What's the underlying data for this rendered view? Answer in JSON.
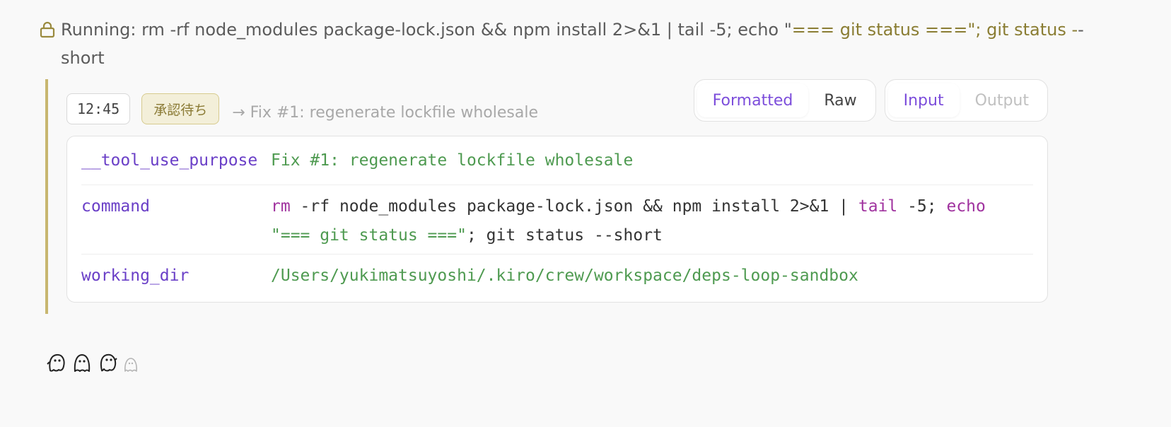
{
  "header": {
    "status_prefix": "Running: ",
    "command_plain": "rm -rf node_modules package-lock.json && npm install 2>&1 | tail -5; echo \"",
    "command_highlight": "=== git status ===\"; git status -",
    "command_tail": "-short"
  },
  "entry": {
    "time": "12:45",
    "status": "承認待ち",
    "purpose_hint": "→ Fix #1: regenerate lockfile wholesale",
    "view_toggle": {
      "formatted": "Formatted",
      "raw": "Raw",
      "active": "formatted"
    },
    "io_toggle": {
      "input": "Input",
      "output": "Output",
      "active": "input"
    },
    "fields": [
      {
        "key": "__tool_use_purpose",
        "value": "Fix #1: regenerate lockfile wholesale"
      },
      {
        "key": "command",
        "tokens": {
          "rm": "rm",
          "seg1": " -rf node_modules package-lock.json && npm install 2>&1 | ",
          "tail": "tail",
          "seg2": " -5; ",
          "echo": "echo",
          "str": "\"=== git status ===\"",
          "seg3": "; git status --short"
        }
      },
      {
        "key": "working_dir",
        "value": "/Users/yukimatsuyoshi/.kiro/crew/workspace/deps-loop-sandbox"
      }
    ]
  },
  "footer": {
    "icons": [
      "ghost-icon",
      "ghost-icon",
      "ghost-icon",
      "ghost-icon"
    ]
  },
  "colors": {
    "accent_purple": "#7c4ddb",
    "status_gold": "#8a7d33",
    "string_green": "#4e9a50",
    "keyword_magenta": "#a0339f"
  }
}
